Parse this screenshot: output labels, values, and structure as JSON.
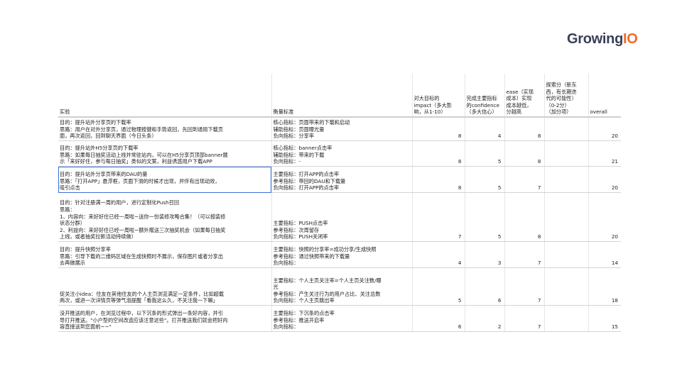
{
  "logo": {
    "part1": "Growing",
    "part2": "IO"
  },
  "table": {
    "headers": {
      "experiment": "实验",
      "metric": "衡量标准",
      "impact": [
        "对大目标的",
        "impact（多大影",
        "响，从1-10）"
      ],
      "confidence": [
        "完成主要指标",
        "的confidence",
        "（多大信心）"
      ],
      "ease": [
        "ease（实现",
        "成本）实现",
        "成本越低，",
        "分越高"
      ],
      "explore": [
        "探索分（新东",
        "西，有长期迭",
        "代的可能性）",
        "（0-2分）",
        "（加分项）"
      ],
      "overall": "overall"
    },
    "rows": [
      {
        "experiment": [
          "目的：提升站外分享页的下载率",
          "思路：用户在对外分享页，通过物理按键和手势返回，先回到通用下载页",
          "面，再次返回，回到聊天界面（今日头条）"
        ],
        "metric": [
          "核心指标：页面带来的下载和启动",
          "辅助指标：页面曝光量",
          "负向指标：分享率"
        ],
        "impact": "8",
        "confidence": "4",
        "ease": "8",
        "explore": "",
        "overall": "20"
      },
      {
        "experiment": [
          "目的：提升站外H5分享页的下载率",
          "思路：如果每日抽奖活动上线并常驻站内，可以在H5分享页顶部banner展",
          "示「来好好住，参与每日抽奖」类似的文案，利益诱惑用户下载APP"
        ],
        "metric": [
          "核心指标：banner点击率",
          "辅助指标：带来的下载",
          "负向指标：-"
        ],
        "impact": "8",
        "confidence": "5",
        "ease": "8",
        "explore": "",
        "overall": "21"
      },
      {
        "experiment": [
          "目的：提升站外分享页带来的DAU的量",
          "思路：「打开APP」悬浮框，页面下滑的时候才出现，并伴有出现动效，",
          "吸引点击"
        ],
        "metric": [
          "主要指标：打开APP的点击率",
          "参考指标：带回的DAU和下载量",
          "负向指标：打开APP的点击率"
        ],
        "impact": "8",
        "confidence": "5",
        "ease": "7",
        "explore": "",
        "overall": "20"
      },
      {
        "experiment": [
          "目的：针对注册满一周的用户，进行定制化Push召回",
          "思路：",
          "1、内容向：来好好住已经一周啦~送你一份装修攻略合集！（可以按装修",
          "状态分群）",
          "2、利益向：来好好住已经一周啦~额外赠送三次抽奖机会（如果每日抽奖",
          "上线，或者抽奖拉新活动持续做）"
        ],
        "metric": [
          "主要指标：PUSH点击率",
          "参考指标：次周留存",
          "负向指标：PUSH关闭率"
        ],
        "impact": "7",
        "confidence": "5",
        "ease": "8",
        "explore": "",
        "overall": "20"
      },
      {
        "experiment": [
          "目的：提升快照分享率",
          "思路：引导下载的二维码区域在生成快照时不展示，保存图片或者分享出",
          "去再做展示"
        ],
        "metric": [
          "主要指标：快照的分享率=成功分享/生成快照",
          "参考指标：通过快照带来的下载量",
          "负向指标："
        ],
        "impact": "4",
        "confidence": "3",
        "ease": "7",
        "explore": "",
        "overall": "14"
      },
      {
        "experiment": [
          "促关注小idea：住友在其他住友的个人主页浏览满足一定条件，比如超载",
          "两次，或进一次详情页等弹气泡提醒「看我这么久，不关注我一下嘛」"
        ],
        "metric": [
          "主要指标：个人主页关注率=个人主页关注数/曝",
          "光",
          "参考指标：产生关注行为的用户占比、关注总数",
          "负向指标：个人主页跳出率"
        ],
        "impact": "5",
        "confidence": "6",
        "ease": "7",
        "explore": "",
        "overall": "18"
      },
      {
        "experiment": [
          "没开推送的用户，在浏览过程中，以下沉条的形式弹出一条好内容，并引",
          "导打开推送。\"小户型的空间改造应该注意这些\"。打开推送我们就会把好内",
          "容直接送到您面前~~\""
        ],
        "metric": [
          "主要指标：下沉条的点击率",
          "参考指标：推送开启率",
          "负向指标："
        ],
        "impact": "6",
        "confidence": "2",
        "ease": "7",
        "explore": "",
        "overall": "15"
      }
    ]
  }
}
